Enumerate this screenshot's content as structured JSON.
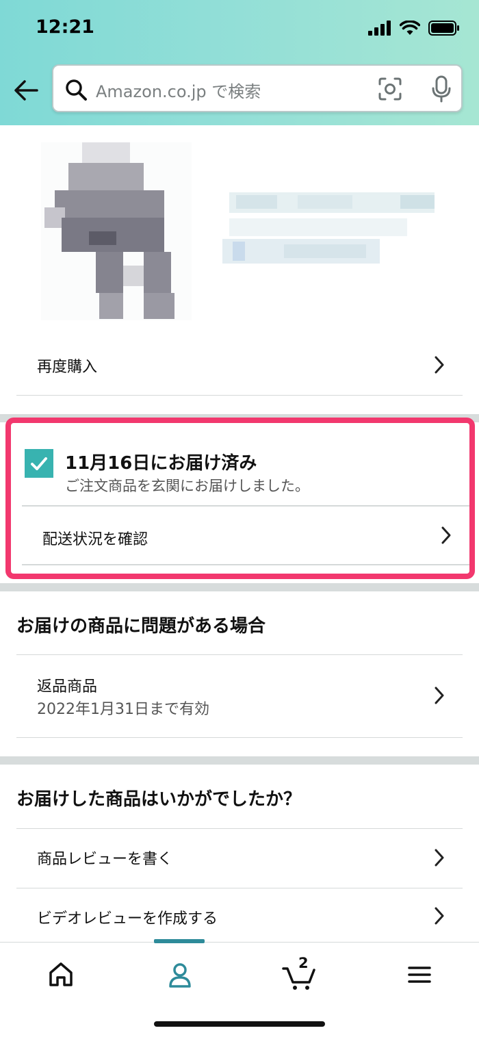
{
  "status_bar": {
    "time": "12:21"
  },
  "search": {
    "placeholder": "Amazon.co.jp で検索"
  },
  "rows": {
    "buy_again": "再度購入",
    "track_package": "配送状況を確認"
  },
  "delivery": {
    "title": "11月16日にお届け済み",
    "subtitle": "ご注文商品を玄関にお届けしました。"
  },
  "problem_section": {
    "title": "お届けの商品に問題がある場合",
    "return_label": "返品商品",
    "return_deadline": "2022年1月31日まで有効"
  },
  "feedback_section": {
    "title": "お届けした商品はいかがでしたか？",
    "write_review": "商品レビューを書く",
    "video_review": "ビデオレビューを作成する"
  },
  "bottom_nav": {
    "items": [
      "home-icon",
      "account-icon",
      "cart-icon",
      "menu-icon"
    ],
    "active": "account-icon",
    "cart_count": "2"
  },
  "colors": {
    "accent": "#f2386e",
    "check": "#38b3b0",
    "nav_active": "#2e8b9a"
  }
}
